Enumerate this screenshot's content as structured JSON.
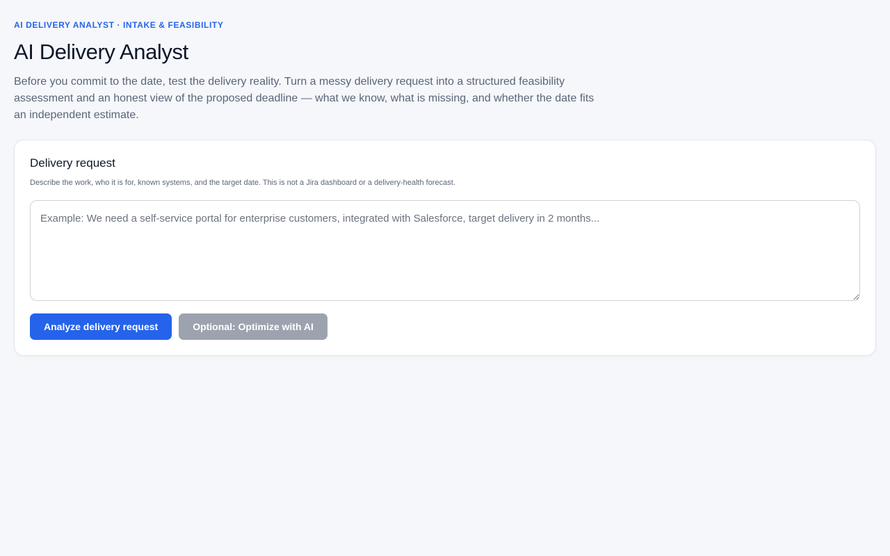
{
  "header": {
    "eyebrow": "AI DELIVERY ANALYST · INTAKE & FEASIBILITY",
    "title": "AI Delivery Analyst",
    "intro": "Before you commit to the date, test the delivery reality. Turn a messy delivery request into a structured feasibility assessment and an honest view of the proposed deadline — what we know, what is missing, and whether the date fits an independent estimate."
  },
  "request_card": {
    "title": "Delivery request",
    "hint": "Describe the work, who it is for, known systems, and the target date. This is not a Jira dashboard or a delivery-health forecast.",
    "input": {
      "value": "",
      "placeholder": "Example: We need a self-service portal for enterprise customers, integrated with Salesforce, target delivery in 2 months..."
    },
    "actions": {
      "analyze_label": "Analyze delivery request",
      "optimize_label": "Optional: Optimize with AI"
    }
  },
  "colors": {
    "accent": "#2563eb",
    "secondary_button": "#9ca3af",
    "background": "#f5f7fa",
    "card": "#ffffff"
  }
}
